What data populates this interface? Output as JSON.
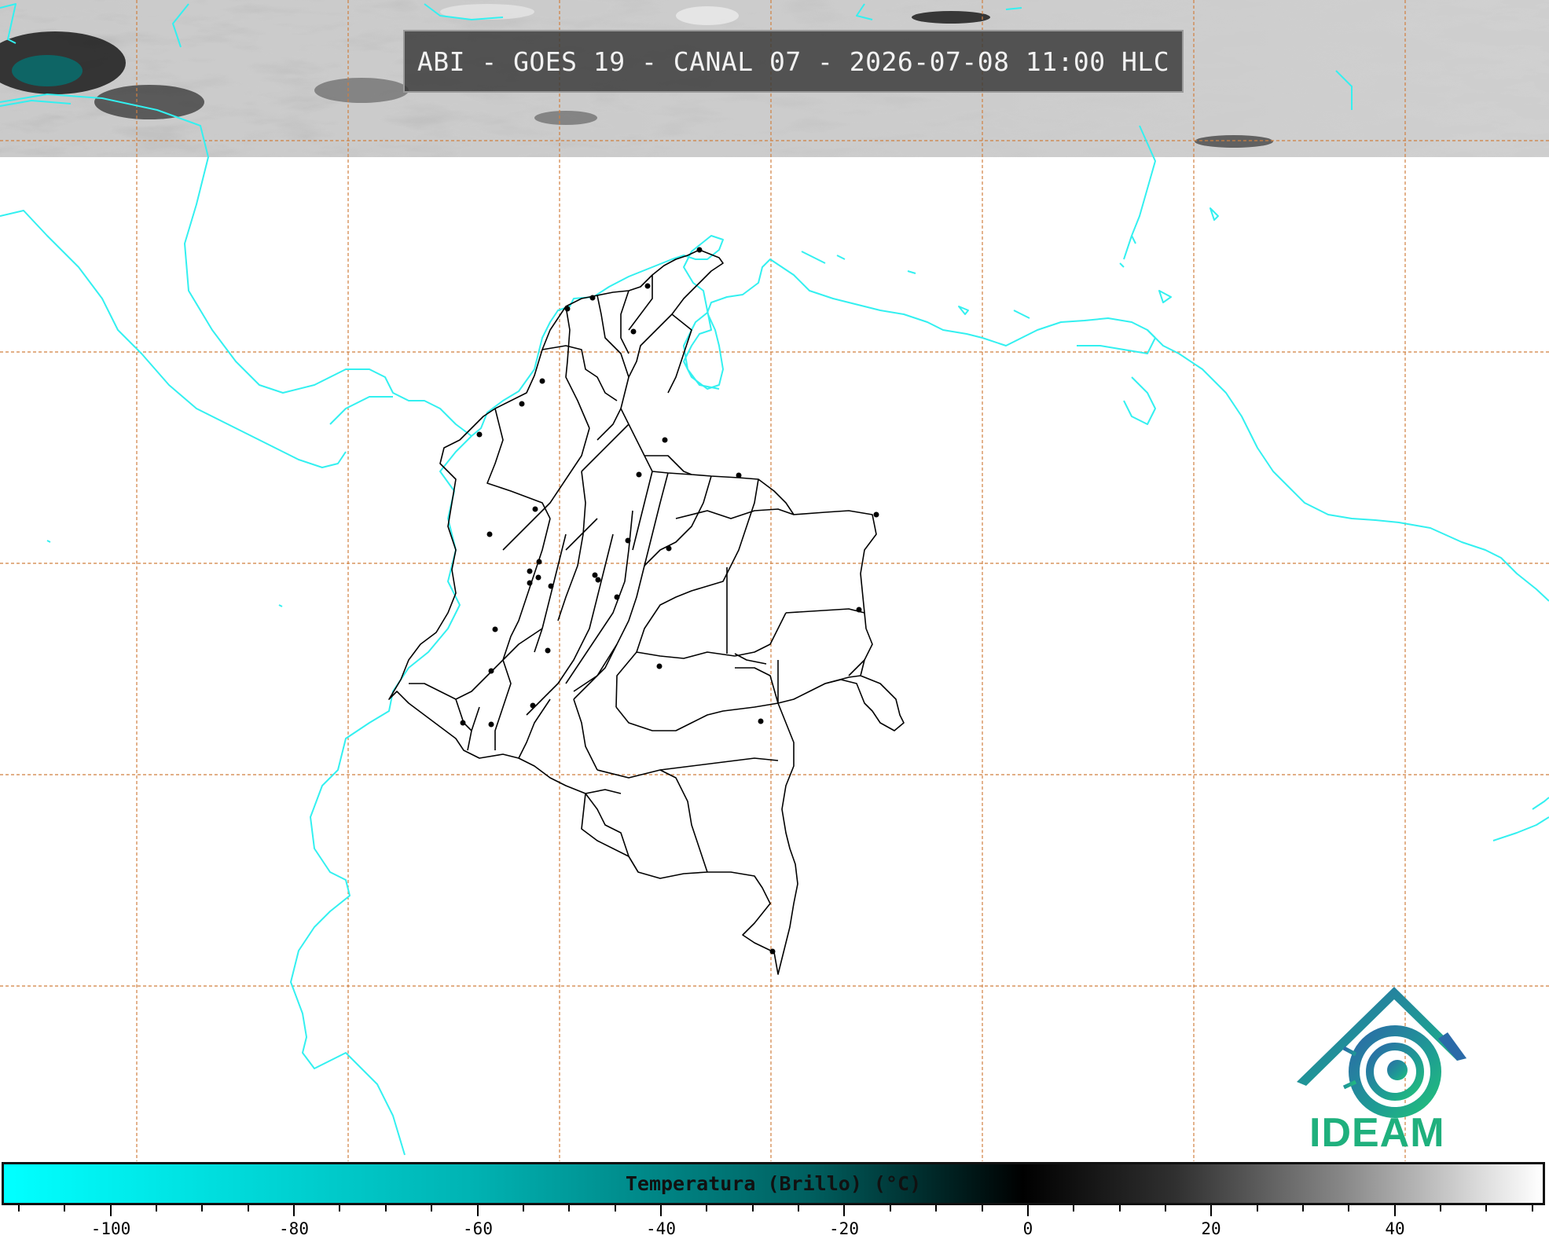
{
  "title": "ABI - GOES 19 - CANAL 07 - 2026-07-08 11:00 HLC",
  "logo": {
    "text": "IDEAM",
    "icon": "ideam-logo-icon",
    "color": "#1fb07d"
  },
  "colorbar": {
    "label": "Temperatura (Brillo) (°C)",
    "ticks": [
      "-100",
      "-80",
      "-60",
      "-40",
      "-20",
      "0",
      "20",
      "40"
    ]
  },
  "colors": {
    "coastline": "#33f0f0",
    "grid": "#d07f3f",
    "borders": "#000000"
  }
}
